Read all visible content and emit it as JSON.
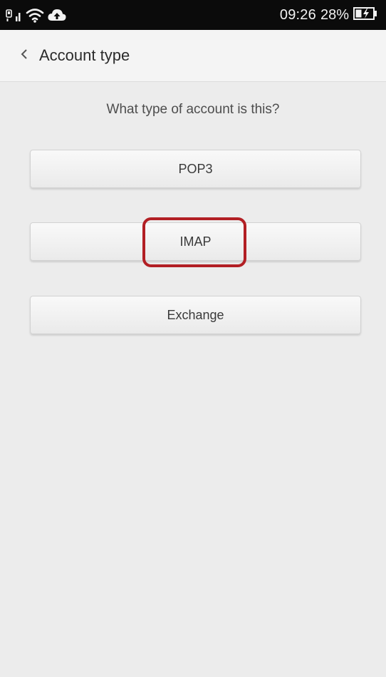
{
  "status_bar": {
    "icons": [
      "sim-card-icon",
      "signal-icon",
      "wifi-icon",
      "cloud-upload-icon",
      "battery-charging-icon"
    ],
    "time": "09:26",
    "battery_percent": "28%"
  },
  "action_bar": {
    "back_icon": "chevron-left-icon",
    "title": "Account type"
  },
  "content": {
    "question": "What type of account is this?",
    "options": [
      {
        "label": "POP3"
      },
      {
        "label": "IMAP",
        "highlighted": true
      },
      {
        "label": "Exchange"
      }
    ]
  },
  "colors": {
    "status_bar_bg": "#0b0b0b",
    "action_bar_bg": "#f4f4f4",
    "content_bg": "#ececec",
    "highlight": "#b21f24"
  }
}
